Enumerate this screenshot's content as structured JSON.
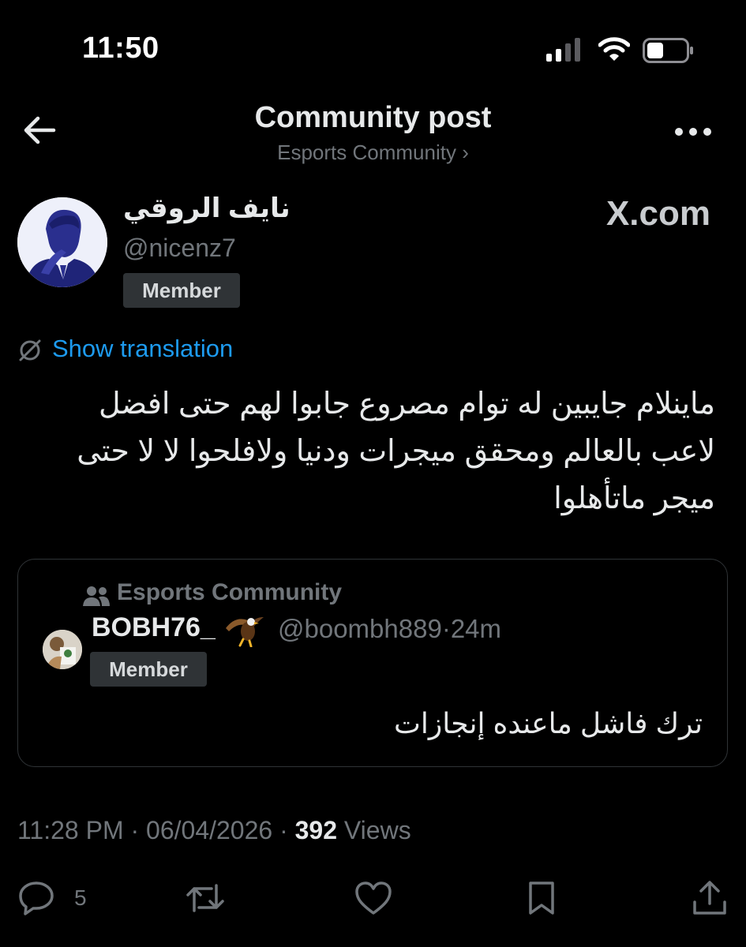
{
  "status_bar": {
    "time": "11:50"
  },
  "header": {
    "title": "Community post",
    "subtitle": "Esports Community ›"
  },
  "author": {
    "display_name": "نايف الروقي",
    "handle": "@nicenz7",
    "badge": "Member"
  },
  "watermark": "X.com",
  "translation_link": "Show translation",
  "post_text": "ماينلام جايبين له توام مصروع جابوا لهم حتى افضل\nلاعب بالعالم ومحقق ميجرات ودنيا ولافلحوا لا لا حتى\nميجر ماتأهلوا",
  "quoted_post": {
    "community": "Esports Community",
    "display_name": "BOBH76_",
    "handle": "@boombh889",
    "separator": "·",
    "time": "24m",
    "badge": "Member",
    "text": "ترك فاشل ماعنده إنجازات"
  },
  "meta": {
    "time": "11:28 PM",
    "separator": "·",
    "date": "06/04/2026",
    "separator2": "·",
    "views_count": "392",
    "views_label": "Views"
  },
  "actions": {
    "reply_count": "5"
  },
  "colors": {
    "background": "#000000",
    "text_primary": "#e7e9ea",
    "text_secondary": "#71767b",
    "link": "#1d9bf0",
    "badge_bg": "#2f3336"
  },
  "icons": {
    "back": "back-arrow-icon",
    "more": "more-icon",
    "translate": "translate-icon",
    "community": "people-icon",
    "reply": "reply-icon",
    "repost": "repost-icon",
    "like": "heart-icon",
    "bookmark": "bookmark-icon",
    "share": "share-icon"
  }
}
